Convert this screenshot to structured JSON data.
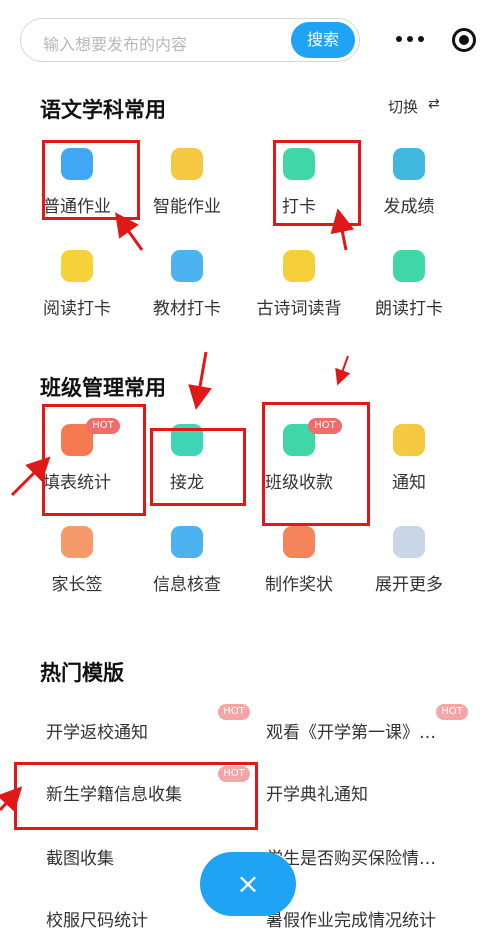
{
  "search": {
    "placeholder": "输入想要发布的内容",
    "button": "搜索"
  },
  "section1": {
    "title": "语文学科常用",
    "switch_label": "切换",
    "switch_icon": "⇄"
  },
  "section1_items": [
    {
      "label": "普通作业",
      "icon": "pencil-icon",
      "color": "#3fa7f5"
    },
    {
      "label": "智能作业",
      "icon": "ai-icon",
      "color": "#f5c842"
    },
    {
      "label": "打卡",
      "icon": "calendar-check-icon",
      "color": "#3fd6a8"
    },
    {
      "label": "发成绩",
      "icon": "grade-icon",
      "color": "#3fb8e0"
    },
    {
      "label": "阅读打卡",
      "icon": "reading-icon",
      "color": "#f5d23a"
    },
    {
      "label": "教材打卡",
      "icon": "textbook-icon",
      "color": "#4cb3f0"
    },
    {
      "label": "古诗词读背",
      "icon": "poem-icon",
      "color": "#f5cf3a"
    },
    {
      "label": "朗读打卡",
      "icon": "microphone-icon",
      "color": "#3fd6a8"
    }
  ],
  "section2": {
    "title": "班级管理常用"
  },
  "section2_items": [
    {
      "label": "填表统计",
      "icon": "form-icon",
      "color": "#f57a52",
      "hot": "HOT"
    },
    {
      "label": "接龙",
      "icon": "relay-list-icon",
      "color": "#3fd6b8",
      "hot": ""
    },
    {
      "label": "班级收款",
      "icon": "payment-icon",
      "color": "#3fd6a8",
      "hot": "HOT"
    },
    {
      "label": "通知",
      "icon": "megaphone-icon",
      "color": "#f5c842",
      "hot": ""
    },
    {
      "label": "家长签",
      "icon": "signature-icon",
      "color": "#f59a6a",
      "hot": ""
    },
    {
      "label": "信息核查",
      "icon": "check-info-icon",
      "color": "#4cb3f0",
      "hot": ""
    },
    {
      "label": "制作奖状",
      "icon": "certificate-icon",
      "color": "#f5845a",
      "hot": ""
    },
    {
      "label": "展开更多",
      "icon": "grid-more-icon",
      "color": "#c9d6e6",
      "hot": ""
    }
  ],
  "section3": {
    "title": "热门模版"
  },
  "templates": [
    {
      "label": "开学返校通知",
      "hot": "HOT"
    },
    {
      "label": "观看《开学第一课》…",
      "hot": "HOT"
    },
    {
      "label": "新生学籍信息收集",
      "hot": "HOT"
    },
    {
      "label": "开学典礼通知",
      "hot": ""
    },
    {
      "label": "截图收集",
      "hot": ""
    },
    {
      "label": "学生是否购买保险情…",
      "hot": ""
    },
    {
      "label": "校服尺码统计",
      "hot": ""
    },
    {
      "label": "暑假作业完成情况统计",
      "hot": ""
    }
  ],
  "fab": {
    "label": "×"
  },
  "colors": {
    "accent": "#1fa3f5",
    "annotation": "#e01818",
    "hot": "#f26b6b"
  }
}
